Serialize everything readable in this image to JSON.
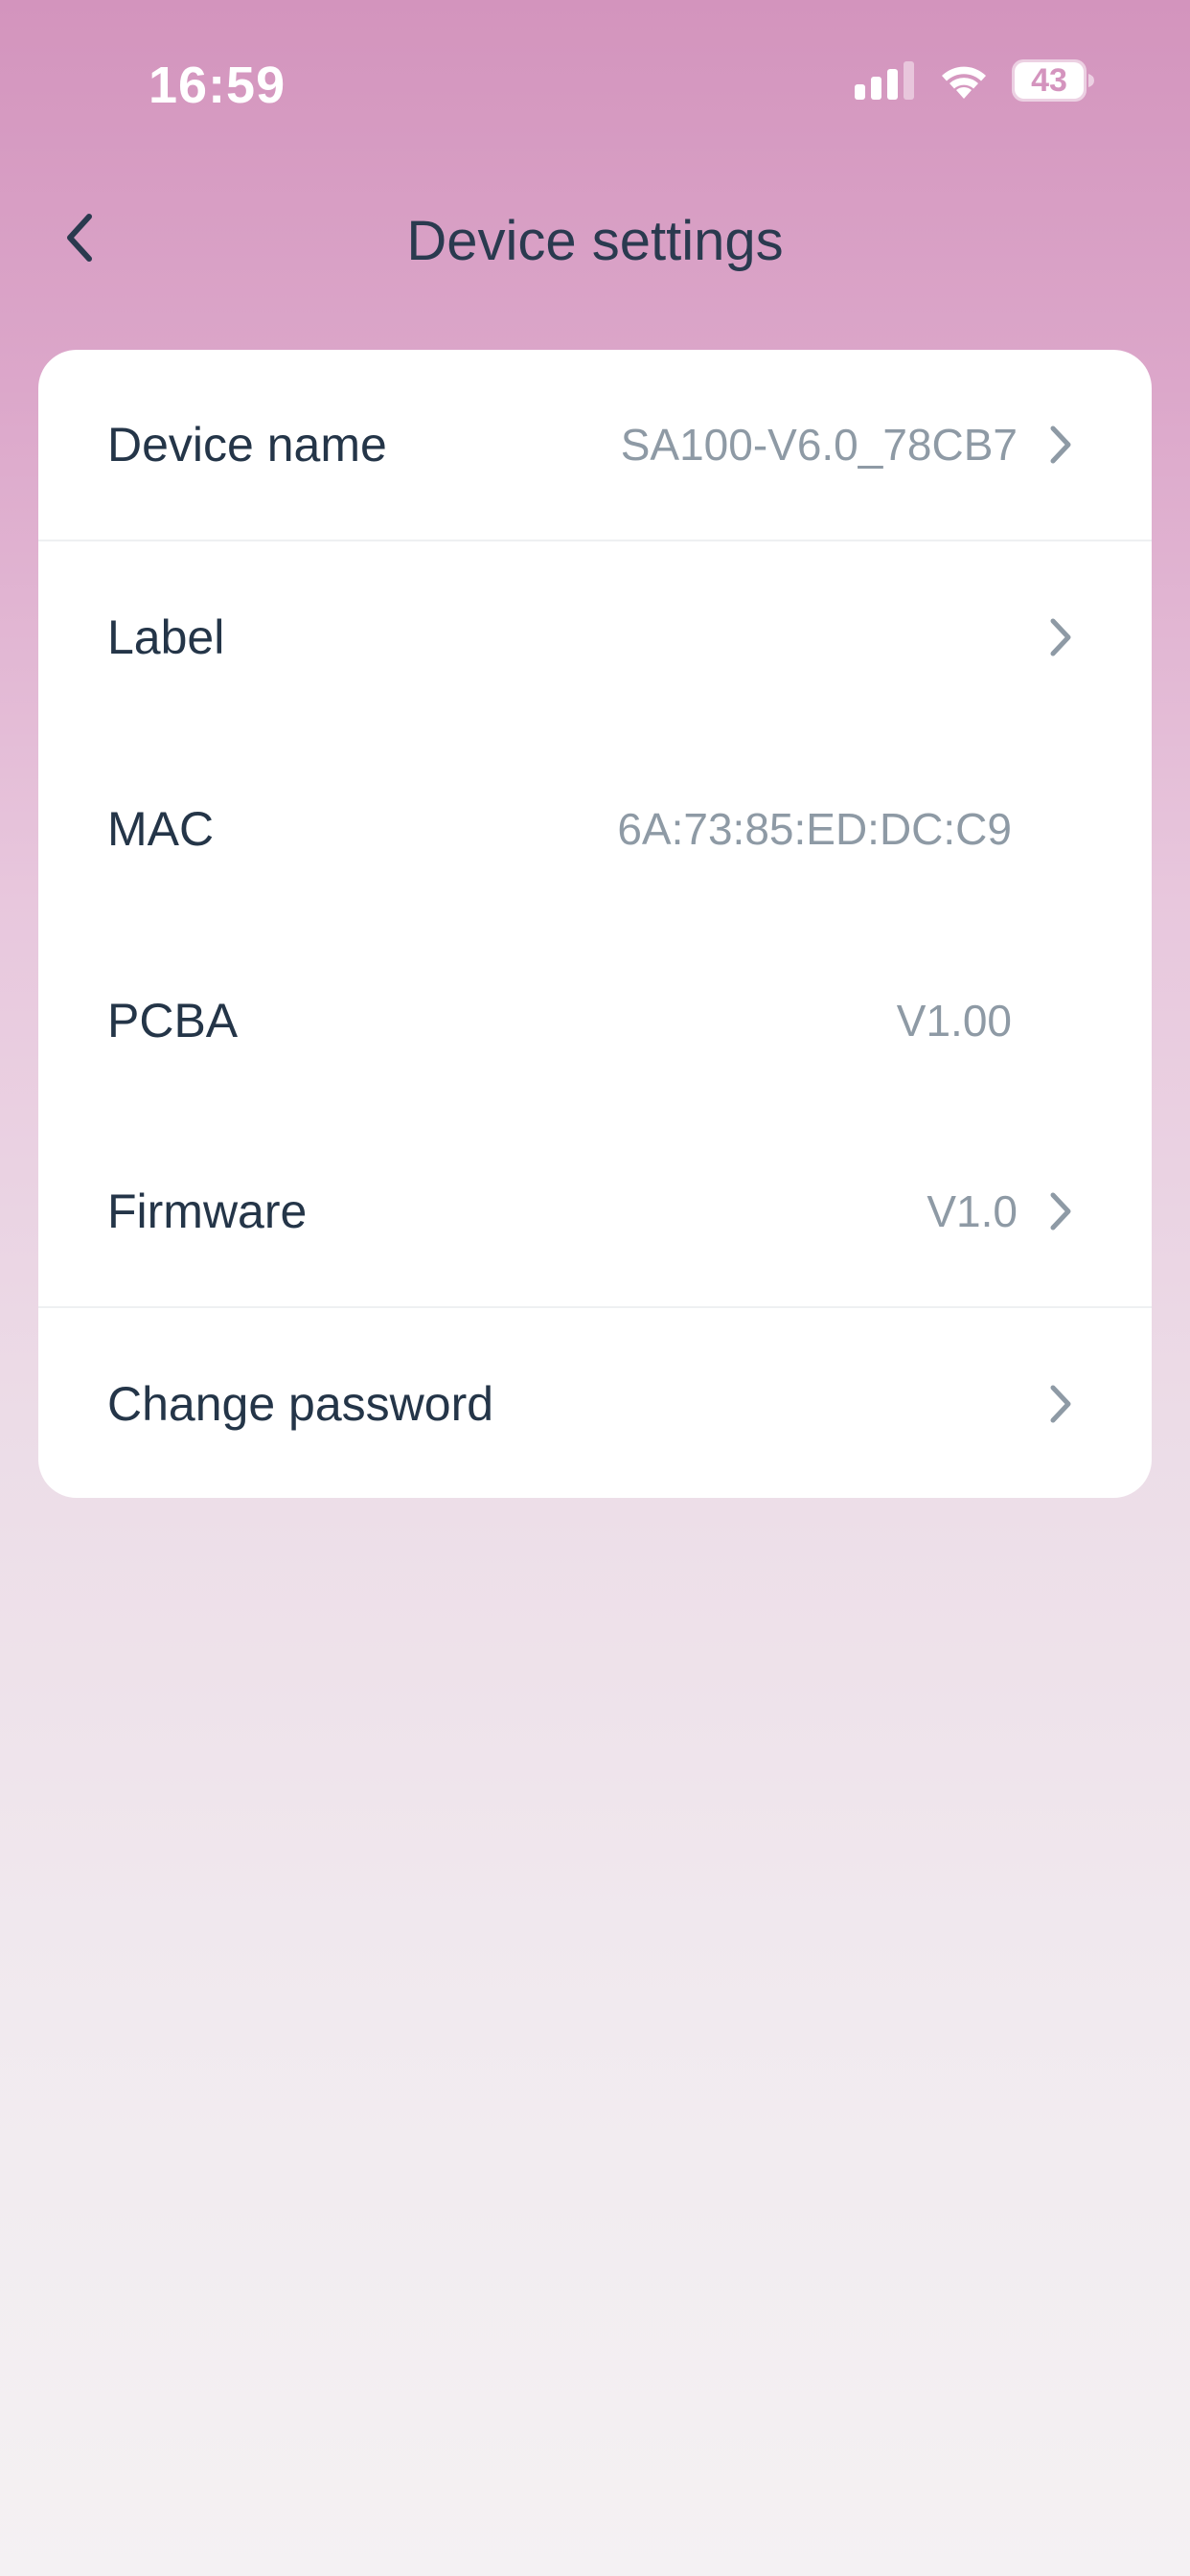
{
  "status_bar": {
    "time": "16:59",
    "battery": "43",
    "icons": [
      "signal-icon",
      "wifi-icon",
      "battery-icon"
    ]
  },
  "header": {
    "title": "Device settings",
    "back_icon": "chevron-left-icon"
  },
  "settings": {
    "device_name": {
      "label": "Device name",
      "value": "SA100-V6.0_78CB7"
    },
    "label": {
      "label": "Label",
      "value": ""
    },
    "mac": {
      "label": "MAC",
      "value": "6A:73:85:ED:DC:C9"
    },
    "pcba": {
      "label": "PCBA",
      "value": "V1.00"
    },
    "firmware": {
      "label": "Firmware",
      "value": "V1.0"
    },
    "change_password": {
      "label": "Change password",
      "value": ""
    }
  },
  "colors": {
    "gradient_top": "#d394bd",
    "gradient_bottom": "#f4f1f3",
    "title_text": "#2a3a4f",
    "value_text": "#8e9aa5",
    "chevron": "#8e9aa5",
    "card_bg": "#ffffff"
  }
}
